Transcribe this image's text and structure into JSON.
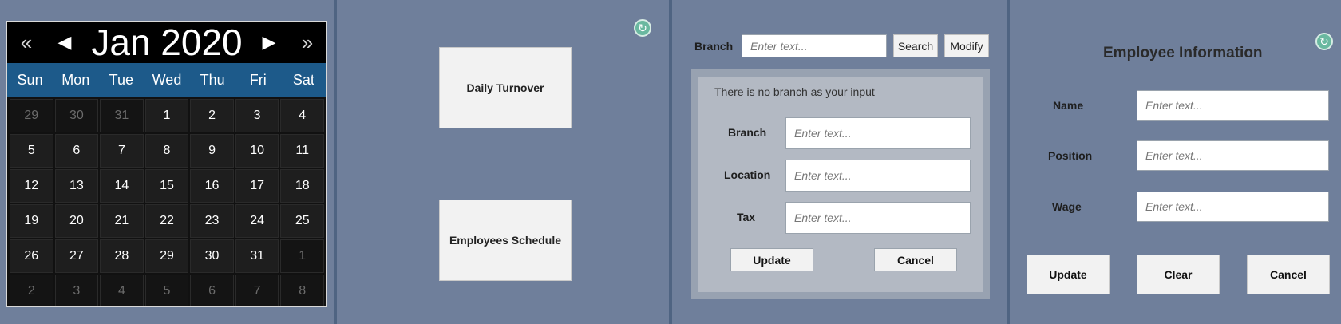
{
  "calendar": {
    "title": "Jan 2020",
    "nav": {
      "prev_year": "«",
      "prev_month": "◀",
      "next_month": "▶",
      "next_year": "»"
    },
    "weekdays": [
      "Sun",
      "Mon",
      "Tue",
      "Wed",
      "Thu",
      "Fri",
      "Sat"
    ],
    "days": [
      {
        "d": "29",
        "m": true
      },
      {
        "d": "30",
        "m": true
      },
      {
        "d": "31",
        "m": true
      },
      {
        "d": "1"
      },
      {
        "d": "2"
      },
      {
        "d": "3"
      },
      {
        "d": "4"
      },
      {
        "d": "5"
      },
      {
        "d": "6"
      },
      {
        "d": "7"
      },
      {
        "d": "8"
      },
      {
        "d": "9"
      },
      {
        "d": "10"
      },
      {
        "d": "11"
      },
      {
        "d": "12"
      },
      {
        "d": "13"
      },
      {
        "d": "14"
      },
      {
        "d": "15"
      },
      {
        "d": "16"
      },
      {
        "d": "17"
      },
      {
        "d": "18"
      },
      {
        "d": "19"
      },
      {
        "d": "20"
      },
      {
        "d": "21"
      },
      {
        "d": "22"
      },
      {
        "d": "23"
      },
      {
        "d": "24"
      },
      {
        "d": "25"
      },
      {
        "d": "26"
      },
      {
        "d": "27"
      },
      {
        "d": "28"
      },
      {
        "d": "29"
      },
      {
        "d": "30"
      },
      {
        "d": "31"
      },
      {
        "d": "1",
        "m": true
      },
      {
        "d": "2",
        "m": true
      },
      {
        "d": "3",
        "m": true
      },
      {
        "d": "4",
        "m": true
      },
      {
        "d": "5",
        "m": true
      },
      {
        "d": "6",
        "m": true
      },
      {
        "d": "7",
        "m": true
      },
      {
        "d": "8",
        "m": true
      }
    ]
  },
  "menu": {
    "daily_turnover": "Daily Turnover",
    "employees_schedule": "Employees Schedule",
    "refresh_icon": "refresh-icon"
  },
  "branch_search": {
    "label": "Branch",
    "placeholder": "Enter text...",
    "search_label": "Search",
    "modify_label": "Modify",
    "message": "There is no branch as your input",
    "fields": {
      "branch_label": "Branch",
      "location_label": "Location",
      "tax_label": "Tax",
      "placeholder": "Enter text..."
    },
    "update_label": "Update",
    "cancel_label": "Cancel"
  },
  "employee": {
    "title": "Employee Information",
    "name_label": "Name",
    "position_label": "Position",
    "wage_label": "Wage",
    "placeholder": "Enter text...",
    "update_label": "Update",
    "clear_label": "Clear",
    "cancel_label": "Cancel",
    "refresh_icon": "refresh-icon"
  },
  "colors": {
    "background": "#6f7f9b",
    "calendar_header": "#000000",
    "weekday_bar": "#1d5a8a",
    "refresh_accent": "#6ab8a0"
  }
}
